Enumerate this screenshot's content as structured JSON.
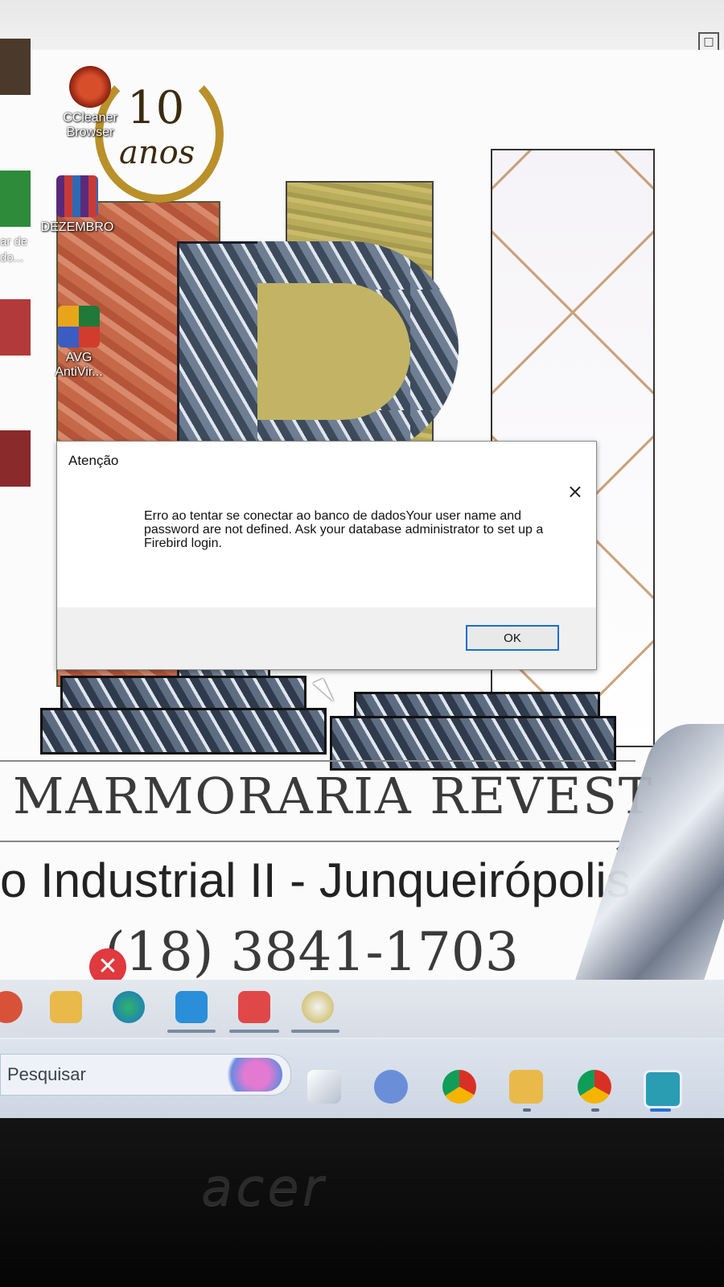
{
  "desktop": {
    "icons": [
      {
        "label": "CCleaner Browser",
        "icon": "ccleaner-icon"
      },
      {
        "label": "DEZEMBRO",
        "icon": "winrar-icon"
      },
      {
        "label": "AVG AntiVir...",
        "icon": "avg-icon"
      }
    ],
    "left_partial_labels": [
      "ar de",
      "do..."
    ],
    "anniversary": {
      "number": "10",
      "word": "anos"
    }
  },
  "wallpaper": {
    "company": "MARMORARIA REVEST",
    "address": "o Industrial II - Junqueirópolis",
    "phone": "(18) 3841-1703",
    "arrows": "‹‹‹"
  },
  "dialog": {
    "title": "Atenção",
    "close_glyph": "×",
    "message": "Erro ao tentar se conectar ao banco de dadosYour user name and password are not defined. Ask your database administrator to set up a Firebird login.",
    "icon": "error-icon",
    "ok_label": "OK",
    "accent": "#1b6fd0",
    "error_color": "#e0393e"
  },
  "taskbar": {
    "search_placeholder": "Pesquisar",
    "pinned": [
      "browser-icon",
      "folder-icon",
      "edge-icon",
      "mail-icon",
      "anydesk-icon",
      "app-icon"
    ],
    "apps": [
      "task-view-icon",
      "meet-icon",
      "chrome-icon",
      "file-explorer-icon",
      "chrome-profile-icon",
      "active-app-icon"
    ]
  },
  "bezel": {
    "brand": "acer"
  }
}
